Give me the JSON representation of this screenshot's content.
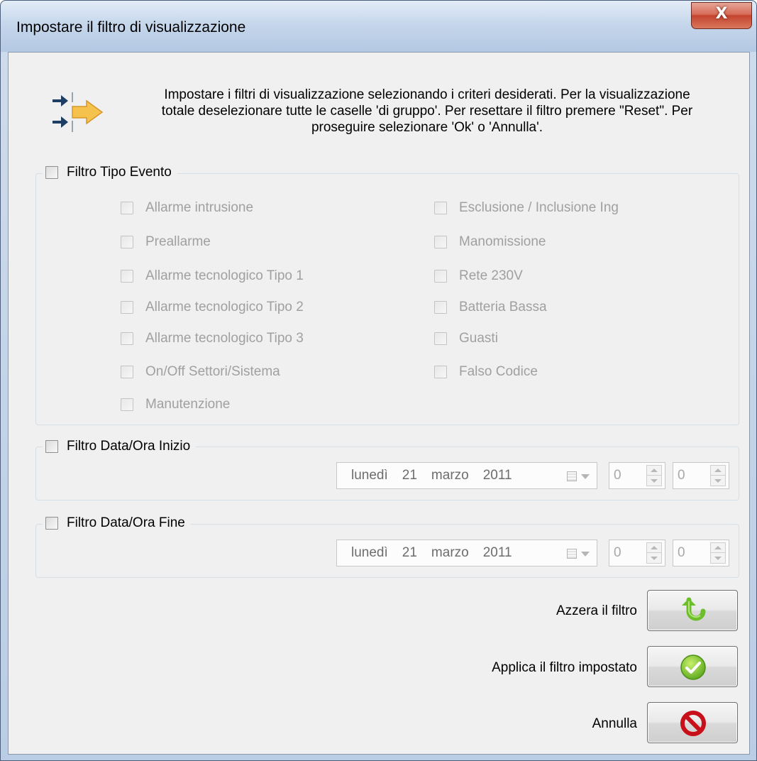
{
  "window": {
    "title": "Impostare il filtro di visualizzazione",
    "close_glyph": "X"
  },
  "info": {
    "icon": "filter-arrows-icon",
    "text_lines": [
      "Impostare i filtri di visualizzazione selezionando i criteri desiderati. Per la visualizzazione",
      "totale deselezionare tutte le caselle 'di gruppo'. Per resettare il filtro premere \"Reset\". Per",
      "proseguire selezionare 'Ok' o 'Annulla'."
    ]
  },
  "event_filter": {
    "label": "Filtro Tipo Evento",
    "checked": false,
    "left_options": [
      "Allarme intrusione",
      "Preallarme",
      "Allarme tecnologico Tipo 1",
      "Allarme tecnologico Tipo 2",
      "Allarme tecnologico Tipo 3",
      "On/Off Settori/Sistema",
      "Manutenzione"
    ],
    "right_options": [
      "Esclusione / Inclusione Ing",
      "Manomissione",
      "Rete 230V",
      "Batteria Bassa",
      "Guasti",
      "Falso Codice"
    ]
  },
  "start_filter": {
    "label": "Filtro Data/Ora Inizio",
    "checked": false,
    "date": {
      "weekday": "lunedì",
      "day": "21",
      "month": "marzo",
      "year": "2011"
    },
    "hour": "0",
    "minute": "0"
  },
  "end_filter": {
    "label": "Filtro Data/Ora Fine",
    "checked": false,
    "date": {
      "weekday": "lunedì",
      "day": "21",
      "month": "marzo",
      "year": "2011"
    },
    "hour": "0",
    "minute": "0"
  },
  "actions": {
    "reset_label": "Azzera il filtro",
    "apply_label": "Applica il filtro impostato",
    "cancel_label": "Annulla"
  },
  "colors": {
    "accent_green": "#6cbf2a",
    "cancel_red": "#c8101a",
    "disabled_text": "#a0a0a0"
  }
}
